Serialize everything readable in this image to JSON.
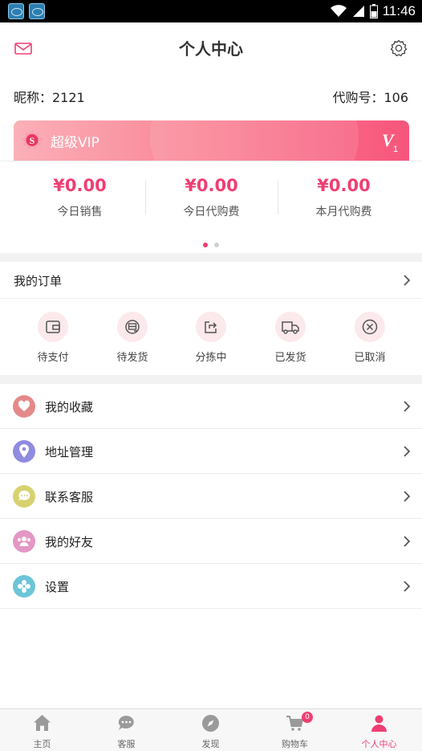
{
  "status_bar": {
    "time": "11:46"
  },
  "header": {
    "title": "个人中心",
    "mail_icon": "mail-icon",
    "settings_icon": "gear-icon"
  },
  "profile": {
    "nickname": "昵称：2121",
    "agent_number": "代购号：106"
  },
  "vip": {
    "label": "超级VIP",
    "badge_letter": "S",
    "level_letter": "V",
    "level_number": "1"
  },
  "stats": {
    "items": [
      {
        "value": "¥0.00",
        "label": "今日销售"
      },
      {
        "value": "¥0.00",
        "label": "今日代购费"
      },
      {
        "value": "¥0.00",
        "label": "本月代购费"
      }
    ],
    "pager": {
      "pages": 2,
      "active": 1
    }
  },
  "orders": {
    "title": "我的订单",
    "items": [
      {
        "label": "待支付",
        "icon": "wallet-icon"
      },
      {
        "label": "待发货",
        "icon": "package-icon"
      },
      {
        "label": "分拣中",
        "icon": "share-box-icon"
      },
      {
        "label": "已发货",
        "icon": "truck-icon"
      },
      {
        "label": "已取消",
        "icon": "cancel-icon"
      }
    ]
  },
  "menu": {
    "items": [
      {
        "label": "我的收藏",
        "icon": "heart-icon",
        "color": "#e48a8a"
      },
      {
        "label": "地址管理",
        "icon": "location-pin-icon",
        "color": "#8f8be0"
      },
      {
        "label": "联系客服",
        "icon": "chat-bubble-icon",
        "color": "#d7d26f"
      },
      {
        "label": "我的好友",
        "icon": "friends-icon",
        "color": "#e497c4"
      },
      {
        "label": "设置",
        "icon": "settings-flower-icon",
        "color": "#6cc5d8"
      }
    ]
  },
  "tabbar": {
    "items": [
      {
        "label": "主页",
        "icon": "home-icon"
      },
      {
        "label": "客服",
        "icon": "chat-icon"
      },
      {
        "label": "发现",
        "icon": "compass-icon"
      },
      {
        "label": "购物车",
        "icon": "cart-icon",
        "badge": "0"
      },
      {
        "label": "个人中心",
        "icon": "person-icon",
        "active": true
      }
    ]
  },
  "colors": {
    "accent": "#f03e72",
    "vip_start": "#fbb0b8",
    "vip_end": "#f7557b",
    "order_icon_bg": "#fbe9ec"
  }
}
